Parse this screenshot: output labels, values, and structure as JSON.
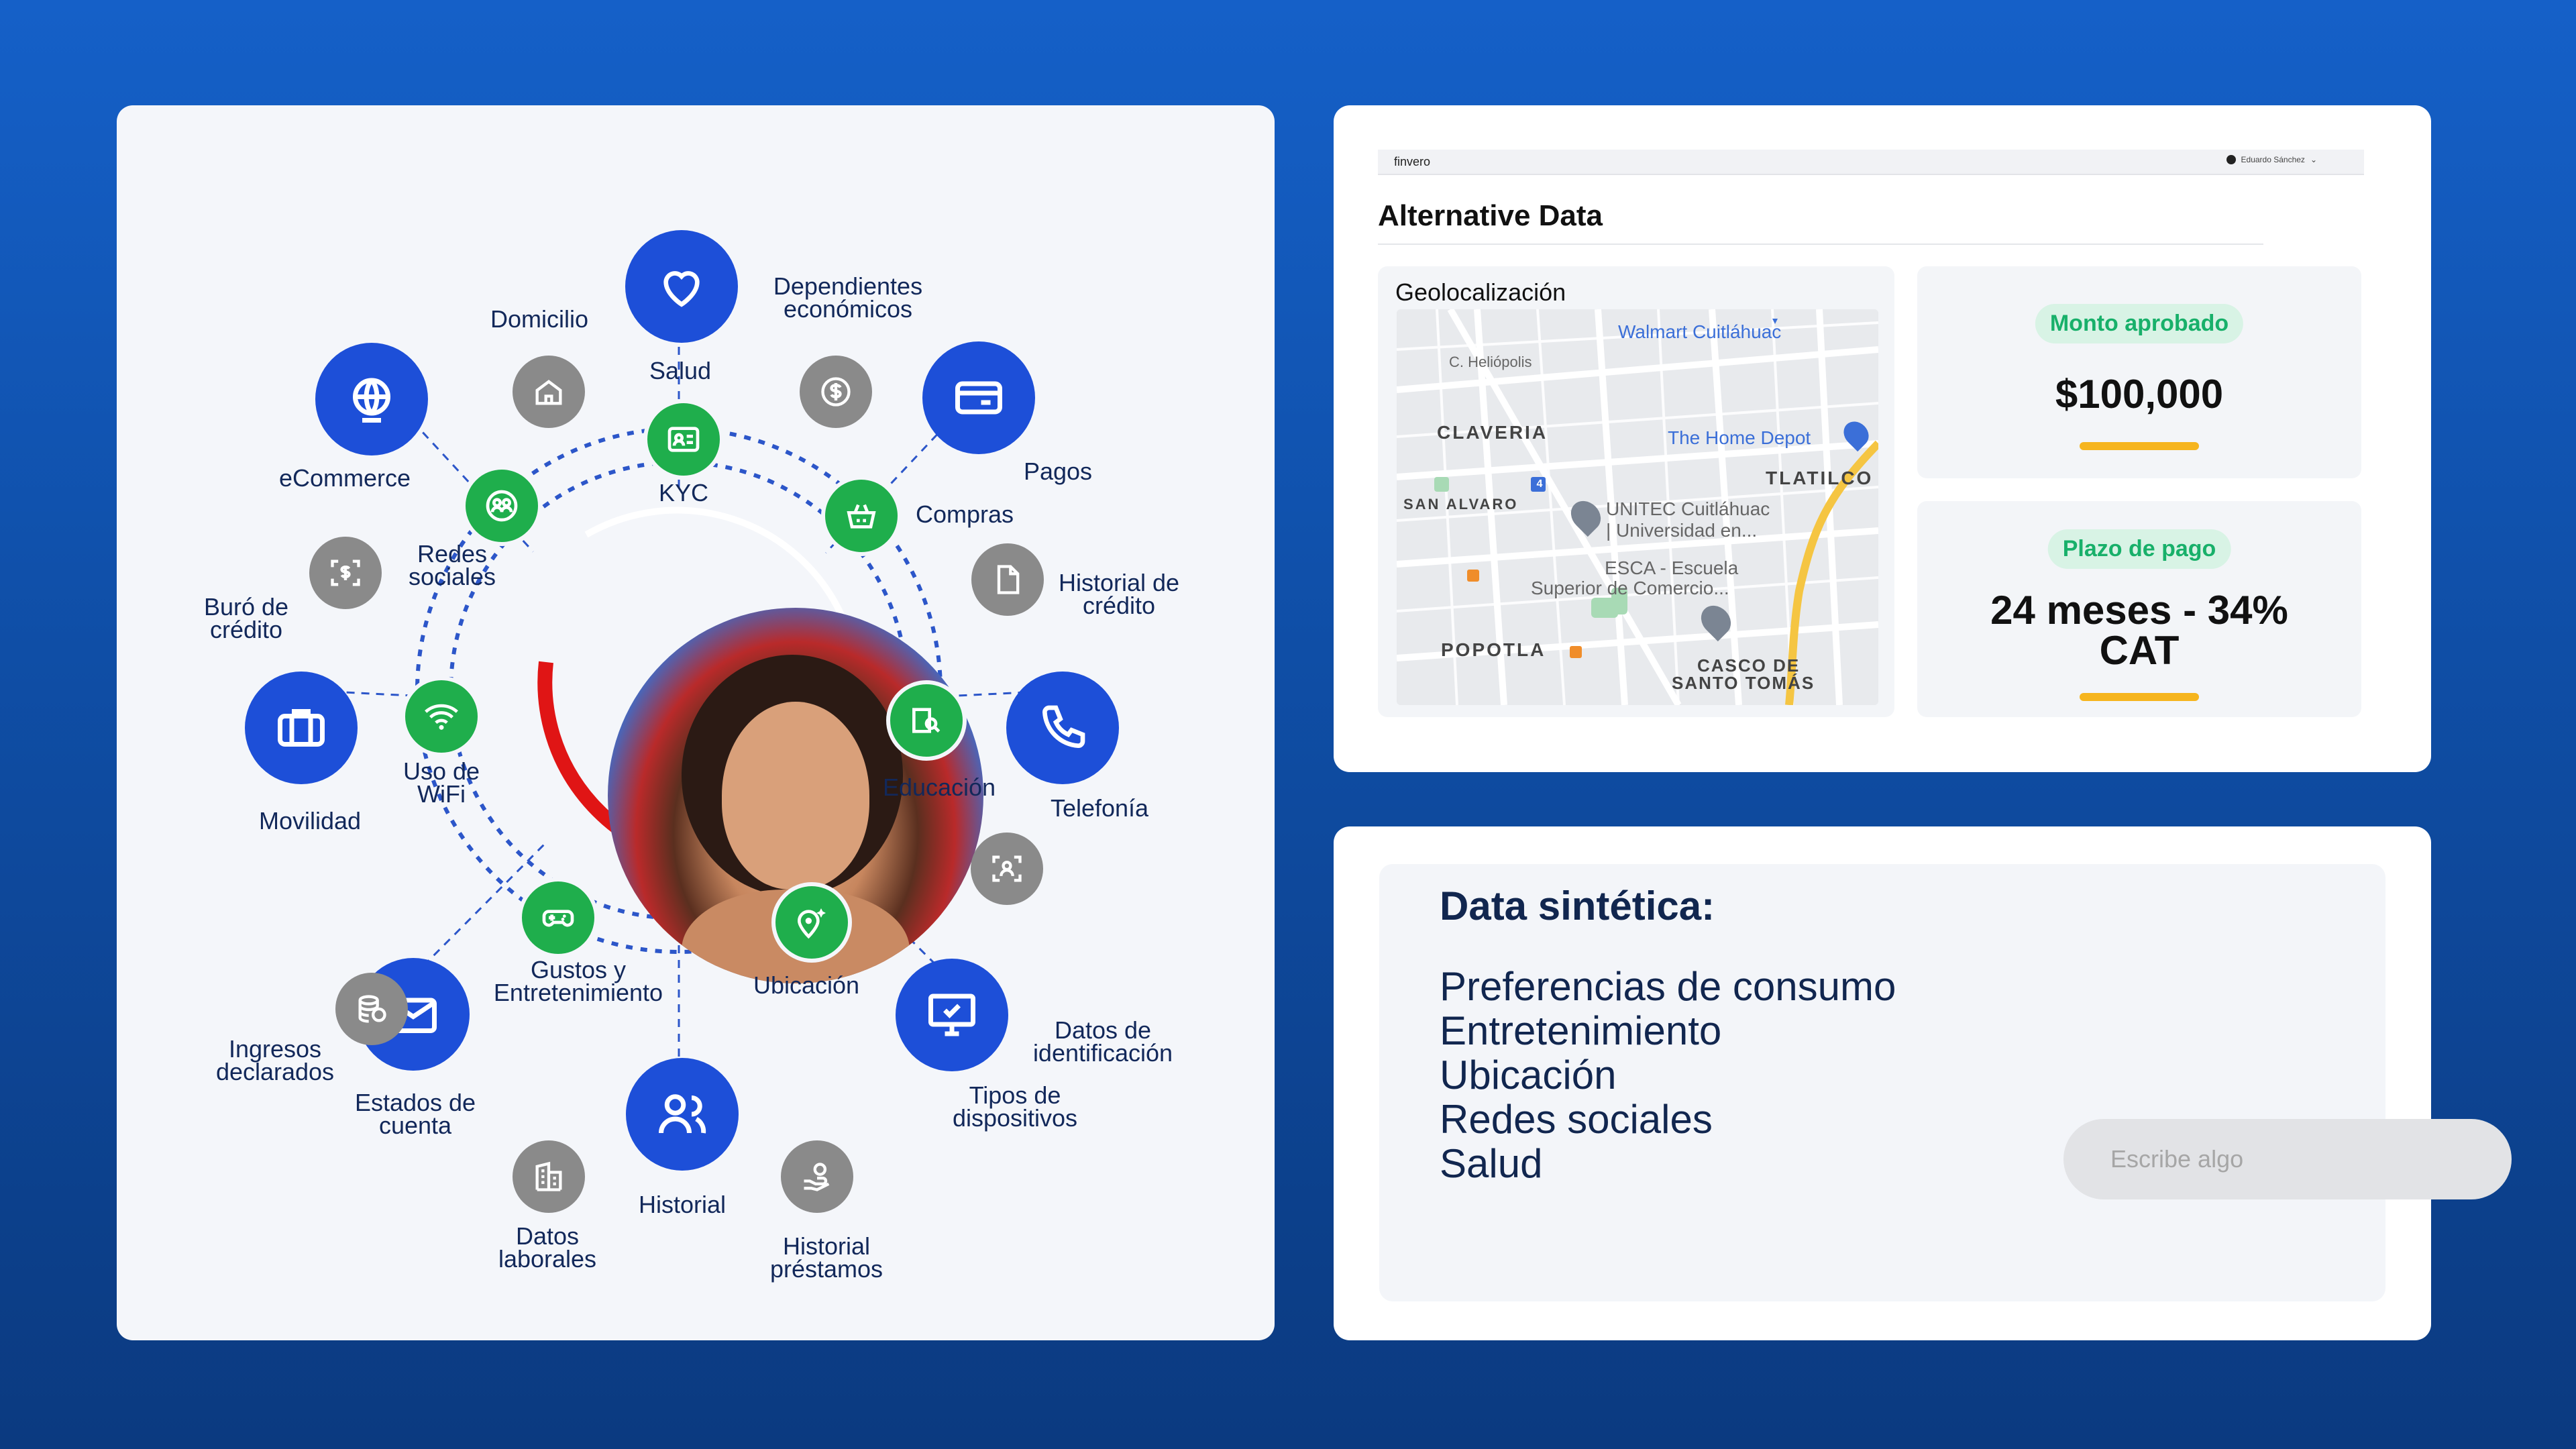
{
  "radial": {
    "center_labels": {
      "kyc": "KYC"
    },
    "blue_nodes": [
      {
        "key": "salud",
        "label": "Salud",
        "icon": "heart-icon"
      },
      {
        "key": "pagos",
        "label": "Pagos",
        "icon": "credit-card-icon"
      },
      {
        "key": "telefonia",
        "label": "Telefonía",
        "icon": "phone-icon"
      },
      {
        "key": "dispositivos",
        "label": "Tipos de\ndispositivos",
        "icon": "monitor-check-icon"
      },
      {
        "key": "historial",
        "label": "Historial",
        "icon": "users-icon"
      },
      {
        "key": "estados",
        "label": "Estados de\ncuenta",
        "icon": "mail-icon"
      },
      {
        "key": "movilidad",
        "label": "Movilidad",
        "icon": "briefcase-icon"
      },
      {
        "key": "ecommerce",
        "label": "eCommerce",
        "icon": "globe-icon"
      }
    ],
    "green_nodes": [
      {
        "key": "kyc",
        "label": "KYC",
        "icon": "id-card-icon"
      },
      {
        "key": "compras",
        "label": "Compras",
        "icon": "basket-icon"
      },
      {
        "key": "educacion",
        "label": "Educación",
        "icon": "book-search-icon"
      },
      {
        "key": "ubicacion",
        "label": "Ubicación",
        "icon": "location-sparkle-icon"
      },
      {
        "key": "gustos",
        "label": "Gustos y\nEntretenimiento",
        "icon": "gamepad-icon"
      },
      {
        "key": "wifi",
        "label": "Uso de\nWiFi",
        "icon": "wifi-icon"
      },
      {
        "key": "redes",
        "label": "Redes\nsociales",
        "icon": "social-users-icon"
      }
    ],
    "gray_nodes": [
      {
        "key": "domicilio",
        "label": "Domicilio",
        "icon": "house-icon"
      },
      {
        "key": "dependientes",
        "label": "Dependientes\neconómicos",
        "icon": "dollar-coin-icon"
      },
      {
        "key": "hist_credito",
        "label": "Historial de\ncrédito",
        "icon": "document-icon"
      },
      {
        "key": "identificacion",
        "label": "Datos de\nidentificación",
        "icon": "face-scan-icon"
      },
      {
        "key": "prestamos",
        "label": "Historial\npréstamos",
        "icon": "hand-coin-icon"
      },
      {
        "key": "laborales",
        "label": "Datos\nlaborales",
        "icon": "building-icon"
      },
      {
        "key": "ingresos",
        "label": "Ingresos\ndeclarados",
        "icon": "coins-stack-icon"
      },
      {
        "key": "buro",
        "label": "Buró de\ncrédito",
        "icon": "scan-dollar-icon"
      }
    ]
  },
  "alt": {
    "brand": "finvero",
    "user": "Eduardo Sánchez",
    "title": "Alternative Data",
    "geo_title": "Geolocalización",
    "map_labels": {
      "walmart": "Walmart Cuitláhuac",
      "heliopolis": "C. Heliópolis",
      "claveria": "CLAVERIA",
      "home_depot": "The Home Depot",
      "tlatilco": "TLATILCO",
      "san_alvaro": "SAN ALVARO",
      "unitec1": "UNITEC Cuitláhuac",
      "unitec2": "| Universidad en...",
      "esca1": "ESCA - Escuela",
      "esca2": "Superior de Comercio...",
      "popotla": "POPOTLA",
      "casco1": "CASCO DE",
      "casco2": "SANTO TOMÁS",
      "road_num": "4"
    },
    "amount": {
      "pill": "Monto aprobado",
      "value": "$100,000"
    },
    "term": {
      "pill": "Plazo de pago",
      "value_line1": "24 meses - 34%",
      "value_line2": "CAT"
    },
    "colors": {
      "accent_yellow": "#f6b51e",
      "pill_green": "#18b06a",
      "blue": "#1d4fd8",
      "green": "#1fae4c",
      "gray": "#8a8a8a"
    }
  },
  "synthetic": {
    "title": "Data sintética:",
    "items": [
      "Preferencias de consumo",
      "Entretenimiento",
      "Ubicación",
      "Redes sociales",
      "Salud"
    ],
    "input_placeholder": "Escribe algo"
  }
}
